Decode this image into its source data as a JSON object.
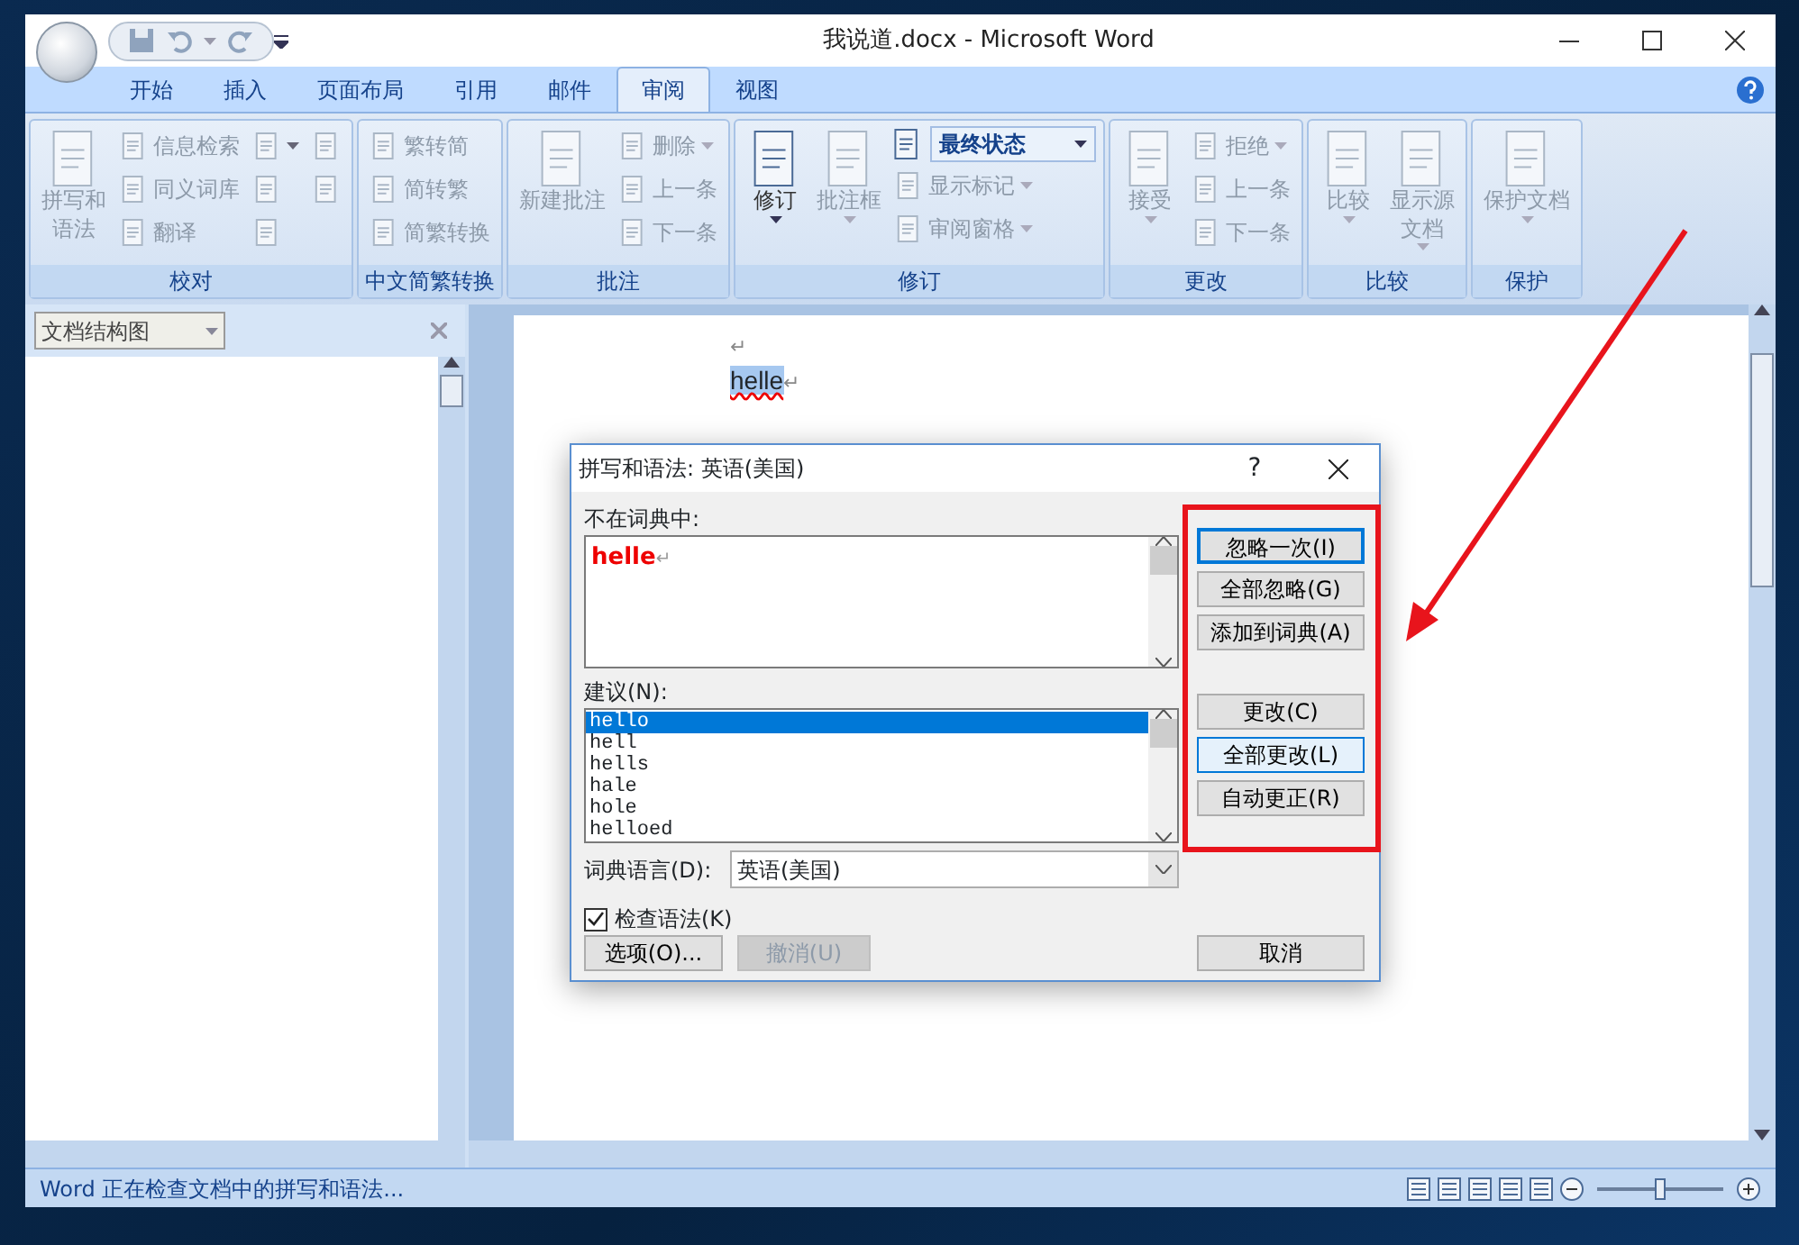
{
  "window": {
    "title": "我说道.docx - Microsoft Word"
  },
  "tabs": [
    {
      "label": "开始",
      "selected": false
    },
    {
      "label": "插入",
      "selected": false
    },
    {
      "label": "页面布局",
      "selected": false
    },
    {
      "label": "引用",
      "selected": false
    },
    {
      "label": "邮件",
      "selected": false
    },
    {
      "label": "审阅",
      "selected": true
    },
    {
      "label": "视图",
      "selected": false
    }
  ],
  "ribbon_groups": [
    {
      "label": "校对",
      "items": [
        {
          "kind": "large",
          "label": "拼写和语法",
          "dropdown": false,
          "disabled": true
        },
        {
          "kind": "stack",
          "items": [
            {
              "kind": "small",
              "label": "信息检索",
              "dropdown": false,
              "disabled": true
            },
            {
              "kind": "small",
              "label": "同义词库",
              "dropdown": false,
              "disabled": true
            },
            {
              "kind": "small",
              "label": "翻译",
              "dropdown": false,
              "disabled": true
            }
          ]
        },
        {
          "kind": "stack",
          "items": [
            {
              "kind": "icon",
              "dropdown": true,
              "disabled": true
            },
            {
              "kind": "icon",
              "dropdown": false,
              "disabled": true
            },
            {
              "kind": "icon",
              "dropdown": false,
              "disabled": true
            }
          ]
        },
        {
          "kind": "stack",
          "items": [
            {
              "kind": "icon",
              "dropdown": false,
              "disabled": true
            },
            {
              "kind": "icon",
              "dropdown": false,
              "disabled": true
            }
          ]
        }
      ]
    },
    {
      "label": "中文简繁转换",
      "items": [
        {
          "kind": "stack",
          "items": [
            {
              "kind": "small",
              "label": "繁转简",
              "dropdown": false,
              "disabled": true
            },
            {
              "kind": "small",
              "label": "简转繁",
              "dropdown": false,
              "disabled": true
            },
            {
              "kind": "small",
              "label": "简繁转换",
              "dropdown": false,
              "disabled": true
            }
          ]
        }
      ]
    },
    {
      "label": "批注",
      "items": [
        {
          "kind": "large",
          "label": "新建批注",
          "dropdown": false,
          "disabled": true
        },
        {
          "kind": "stack",
          "items": [
            {
              "kind": "small",
              "label": "删除",
              "dropdown": true,
              "disabled": true
            },
            {
              "kind": "small",
              "label": "上一条",
              "dropdown": false,
              "disabled": true
            },
            {
              "kind": "small",
              "label": "下一条",
              "dropdown": false,
              "disabled": true
            }
          ]
        }
      ]
    },
    {
      "label": "修订",
      "items": [
        {
          "kind": "large",
          "label": "修订",
          "dropdown": true,
          "disabled": false
        },
        {
          "kind": "large",
          "label": "批注框",
          "dropdown": true,
          "disabled": true
        },
        {
          "kind": "stack",
          "items": [
            {
              "kind": "select",
              "value": "最终状态",
              "disabled": false
            },
            {
              "kind": "small",
              "label": "显示标记",
              "dropdown": true,
              "disabled": true
            },
            {
              "kind": "small",
              "label": "审阅窗格",
              "dropdown": true,
              "disabled": true
            }
          ]
        }
      ]
    },
    {
      "label": "更改",
      "items": [
        {
          "kind": "large",
          "label": "接受",
          "dropdown": true,
          "disabled": true
        },
        {
          "kind": "stack",
          "items": [
            {
              "kind": "small",
              "label": "拒绝",
              "dropdown": true,
              "disabled": true
            },
            {
              "kind": "small",
              "label": "上一条",
              "dropdown": false,
              "disabled": true
            },
            {
              "kind": "small",
              "label": "下一条",
              "dropdown": false,
              "disabled": true
            }
          ]
        }
      ]
    },
    {
      "label": "比较",
      "items": [
        {
          "kind": "large",
          "label": "比较",
          "dropdown": true,
          "disabled": true
        },
        {
          "kind": "large",
          "label": "显示源文档",
          "dropdown": true,
          "disabled": true
        }
      ]
    },
    {
      "label": "保护",
      "items": [
        {
          "kind": "large",
          "label": "保护文档",
          "dropdown": true,
          "disabled": true
        }
      ]
    }
  ],
  "nav_pane": {
    "view": "文档结构图"
  },
  "document": {
    "paragraphs": [
      {
        "end_mark": "↵",
        "selected": false
      },
      {
        "text": "helle",
        "end_mark": "↵",
        "selected": true
      }
    ]
  },
  "dialog": {
    "title": "拼写和语法: 英语(美国)",
    "help": "?",
    "not_in_dictionary": {
      "label": "不在词典中:",
      "text": "helle",
      "end_mark": "↵"
    },
    "suggestions": {
      "label": "建议(N):",
      "items": [
        {
          "text": "hello",
          "selected": true
        },
        {
          "text": "hell",
          "selected": false
        },
        {
          "text": "hells",
          "selected": false
        },
        {
          "text": "hale",
          "selected": false
        },
        {
          "text": "hole",
          "selected": false
        },
        {
          "text": "helloed",
          "selected": false
        }
      ]
    },
    "dictionary_language": {
      "label": "词典语言(D):",
      "value": "英语(美国)"
    },
    "check_grammar": {
      "label": "检查语法(K)",
      "checked": true
    },
    "side_buttons": [
      [
        {
          "label": "忽略一次(I)",
          "default": true,
          "hovered": false
        },
        {
          "label": "全部忽略(G)",
          "default": false,
          "hovered": false
        },
        {
          "label": "添加到词典(A)",
          "default": false,
          "hovered": false
        }
      ],
      [
        {
          "label": "更改(C)",
          "default": false,
          "hovered": false
        },
        {
          "label": "全部更改(L)",
          "default": false,
          "hovered": true
        },
        {
          "label": "自动更正(R)",
          "default": false,
          "hovered": false
        }
      ]
    ],
    "bottom_buttons": [
      {
        "label": "选项(O)...",
        "disabled": false
      },
      {
        "label": "撤消(U)",
        "disabled": true
      }
    ],
    "cancel": "取消"
  },
  "status_bar": {
    "text": "Word 正在检查文档中的拼写和语法...",
    "zoom": {
      "level": 0.5
    }
  }
}
